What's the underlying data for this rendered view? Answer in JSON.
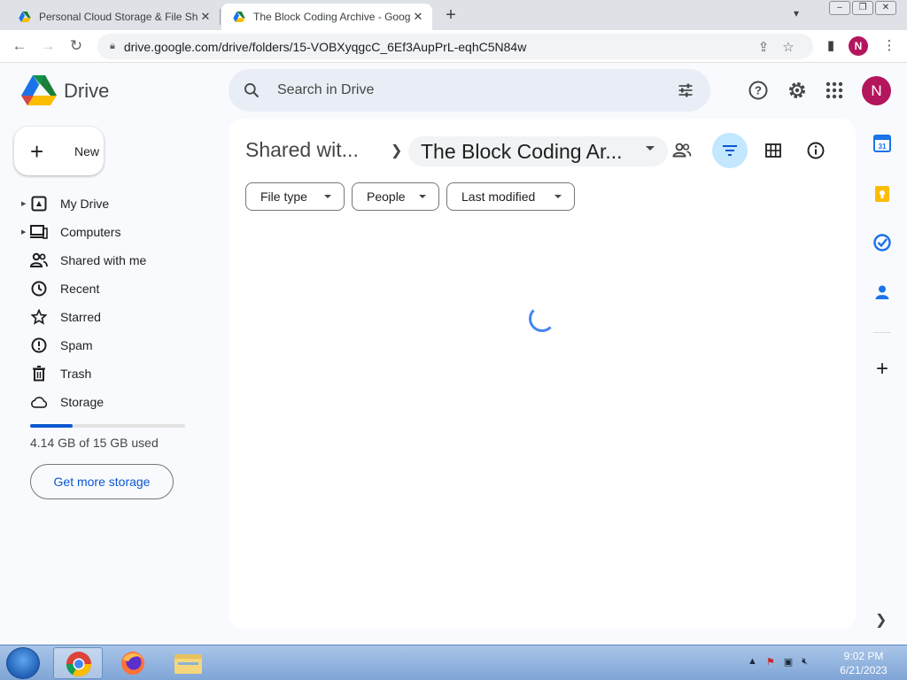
{
  "browser": {
    "tabs": [
      {
        "title": "Personal Cloud Storage & File Sh",
        "active": false
      },
      {
        "title": "The Block Coding Archive - Goog",
        "active": true
      }
    ],
    "url": "drive.google.com/drive/folders/15-VOBXyqgcC_6Ef3AupPrL-eqhC5N84w",
    "profile_initial": "N"
  },
  "drive": {
    "app_name": "Drive",
    "search_placeholder": "Search in Drive",
    "avatar_initial": "N",
    "new_label": "New",
    "nav": [
      {
        "label": "My Drive",
        "icon": "my-drive-icon",
        "expandable": true
      },
      {
        "label": "Computers",
        "icon": "computers-icon",
        "expandable": true
      },
      {
        "label": "Shared with me",
        "icon": "shared-with-me-icon",
        "expandable": false
      },
      {
        "label": "Recent",
        "icon": "clock-icon",
        "expandable": false
      },
      {
        "label": "Starred",
        "icon": "star-icon",
        "expandable": false
      },
      {
        "label": "Spam",
        "icon": "spam-icon",
        "expandable": false
      },
      {
        "label": "Trash",
        "icon": "trash-icon",
        "expandable": false
      },
      {
        "label": "Storage",
        "icon": "cloud-icon",
        "expandable": false
      }
    ],
    "storage": {
      "used_text": "4.14 GB of 15 GB used",
      "fraction_used": 0.276,
      "cta": "Get more storage"
    },
    "breadcrumb": {
      "parent": "Shared wit...",
      "current": "The Block Coding Ar..."
    },
    "filters": [
      "File type",
      "People",
      "Last modified"
    ],
    "loading": true
  },
  "taskbar": {
    "time": "9:02 PM",
    "date": "6/21/2023"
  },
  "colors": {
    "accent": "#0b57d0",
    "avatar": "#b3165d",
    "active_filter_bg": "#c2e7ff",
    "page_bg": "#f8fafd"
  }
}
